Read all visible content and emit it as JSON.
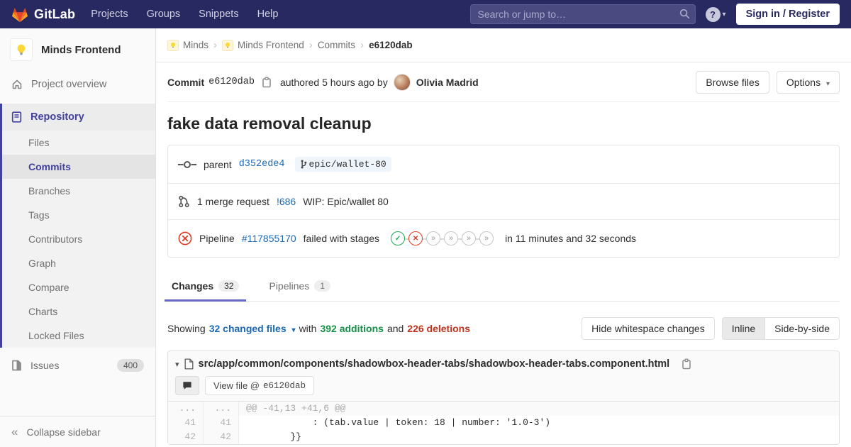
{
  "colors": {
    "navbar_bg": "#292961",
    "tab_accent": "#6666c4",
    "sidebar_active": "#41419f",
    "link_blue": "#1b69b6",
    "additions_green": "#168f48",
    "deletions_red": "#c0341d",
    "passed_green": "#1aaa55",
    "failed_red": "#db3b21",
    "brand_orange": "#fc6d26"
  },
  "navbar": {
    "brand": "GitLab",
    "menu": [
      "Projects",
      "Groups",
      "Snippets",
      "Help"
    ],
    "search_placeholder": "Search or jump to…",
    "help_glyph": "?",
    "sign_in_label": "Sign in / Register"
  },
  "sidebar": {
    "project_name": "Minds Frontend",
    "overview_label": "Project overview",
    "repository_label": "Repository",
    "repo_items": [
      "Files",
      "Commits",
      "Branches",
      "Tags",
      "Contributors",
      "Graph",
      "Compare",
      "Charts",
      "Locked Files"
    ],
    "active_item": "Commits",
    "issues_label": "Issues",
    "issues_count": "400",
    "collapse_icon": "«",
    "collapse_label": "Collapse sidebar"
  },
  "breadcrumb": {
    "group": "Minds",
    "project": "Minds Frontend",
    "section": "Commits",
    "sha": "e6120dab",
    "separator": "›"
  },
  "commit_header": {
    "label": "Commit",
    "sha": "e6120dab",
    "authored": "authored 5 hours ago by",
    "author": "Olivia Madrid",
    "browse_button": "Browse files",
    "options_button": "Options",
    "options_caret": "▾"
  },
  "commit": {
    "title": "fake data removal cleanup",
    "parent_label": "parent",
    "parent_sha": "d352ede4",
    "branch_ref": "epic/wallet-80",
    "mr_count_text": "1 merge request",
    "mr_link": "!686",
    "mr_title": "WIP: Epic/wallet 80",
    "pipeline_label": "Pipeline",
    "pipeline_link": "#117855170",
    "pipeline_status_text": "failed with stages",
    "pipeline_stages": [
      "passed",
      "failed",
      "skipped",
      "skipped",
      "skipped",
      "skipped"
    ],
    "stage_glyphs": {
      "passed": "✓",
      "failed": "✕",
      "skipped": "»"
    },
    "pipeline_duration": "in 11 minutes and 32 seconds"
  },
  "tabs": {
    "changes_label": "Changes",
    "changes_count": "32",
    "pipelines_label": "Pipelines",
    "pipelines_count": "1"
  },
  "diff_summary": {
    "prefix": "Showing",
    "files_link": "32 changed files",
    "files_caret": "▾",
    "middle": "with",
    "additions": "392 additions",
    "conjunction": "and",
    "deletions": "226 deletions",
    "whitespace_button": "Hide whitespace changes",
    "inline_button": "Inline",
    "side_by_side_button": "Side-by-side"
  },
  "diff_file": {
    "collapse_caret": "▾",
    "path": "src/app/common/components/shadowbox-header-tabs/shadowbox-header-tabs.component.html",
    "view_file_prefix": "View file @",
    "view_file_sha": "e6120dab",
    "rows": [
      {
        "old": "...",
        "new": "...",
        "code": "@@ -41,13 +41,6 @@",
        "type": "hunk"
      },
      {
        "old": "41",
        "new": "41",
        "code": "            : (tab.value | token: 18 | number: '1.0-3')",
        "type": "context"
      },
      {
        "old": "42",
        "new": "42",
        "code": "        }}",
        "type": "context"
      }
    ]
  }
}
